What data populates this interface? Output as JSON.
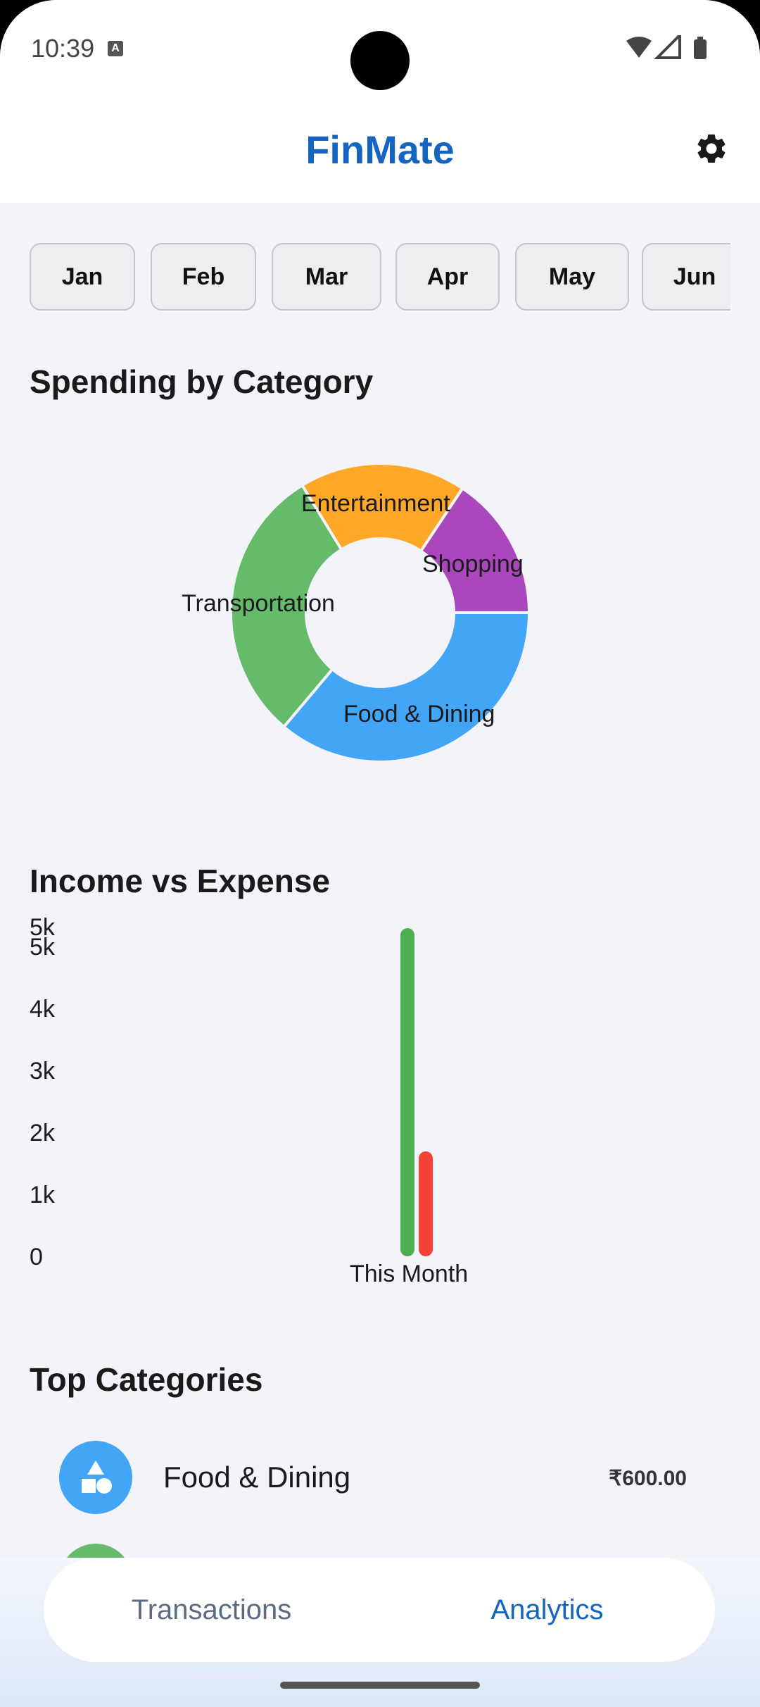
{
  "status": {
    "time": "10:39",
    "notification_icon": "a-icon"
  },
  "app": {
    "title": "FinMate",
    "settings_icon": "gear-icon"
  },
  "months": [
    "Jan",
    "Feb",
    "Mar",
    "Apr",
    "May",
    "Jun"
  ],
  "sections": {
    "spending": "Spending by Category",
    "income_expense": "Income vs Expense",
    "top": "Top Categories"
  },
  "chart_data": [
    {
      "type": "pie",
      "title": "Spending by Category",
      "labels": [
        "Food & Dining",
        "Transportation",
        "Entertainment",
        "Shopping"
      ],
      "values": [
        600,
        500,
        300,
        260
      ],
      "colors": [
        "#42a5f5",
        "#66bb6a",
        "#ffa726",
        "#ab47bc"
      ]
    },
    {
      "type": "bar",
      "title": "Income vs Expense",
      "categories": [
        "This Month"
      ],
      "series": [
        {
          "values": [
            5000
          ],
          "color": "#4caf50"
        },
        {
          "values": [
            1600
          ],
          "color": "#f44336"
        }
      ],
      "y_ticks": [
        "0",
        "1k",
        "2k",
        "3k",
        "4k",
        "5k",
        "5k"
      ],
      "ylim": [
        0,
        5300
      ]
    }
  ],
  "top_categories": [
    {
      "name": "Food & Dining",
      "amount": "₹600.00",
      "color": "#42a5f5",
      "icon": "shapes-icon"
    },
    {
      "name": "",
      "amount": "",
      "color": "#66bb6a",
      "icon": "car-icon"
    }
  ],
  "nav": {
    "transactions": "Transactions",
    "analytics": "Analytics",
    "active": "analytics"
  },
  "colors": {
    "brand": "#1565c0",
    "income": "#4caf50",
    "expense": "#f44336"
  }
}
